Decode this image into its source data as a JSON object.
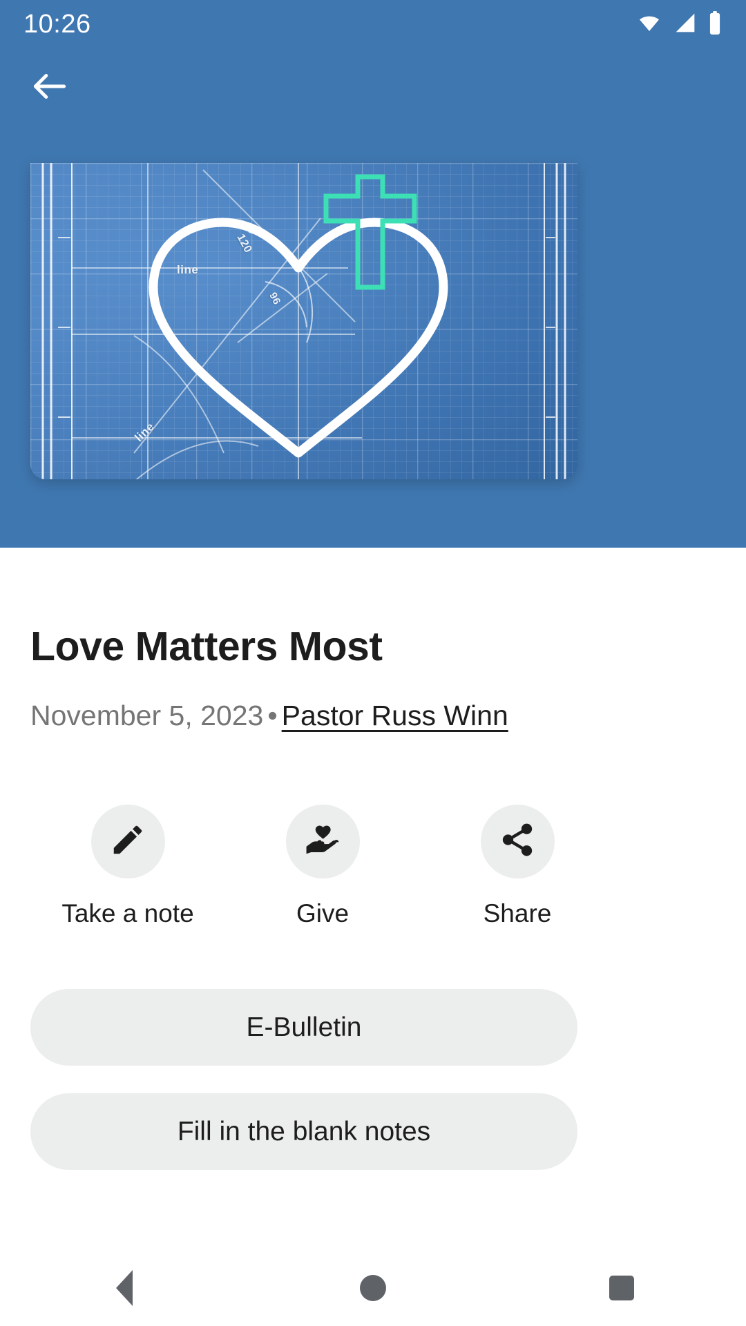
{
  "status_bar": {
    "time": "10:26",
    "icons": [
      "wifi-icon",
      "cell-signal-icon",
      "battery-icon"
    ]
  },
  "header": {
    "back_icon": "arrow-back-icon",
    "background_color": "#3f77b0"
  },
  "hero_image": {
    "alt": "blueprint heart with cross",
    "cross_color": "#3ddfb5",
    "blueprint_color": "#3d78bd",
    "labels": {
      "line_1": "line",
      "line_2": "line",
      "angle_120": "120",
      "angle_96": "96"
    }
  },
  "sermon": {
    "title": "Love Matters Most",
    "date": "November 5, 2023",
    "separator": "•",
    "speaker": "Pastor Russ Winn"
  },
  "actions": [
    {
      "label": "Take a note",
      "icon": "pencil-icon"
    },
    {
      "label": "Give",
      "icon": "hand-holding-heart-icon"
    },
    {
      "label": "Share",
      "icon": "share-nodes-icon"
    }
  ],
  "resources": [
    {
      "label": "E-Bulletin"
    },
    {
      "label": "Fill in the blank notes"
    }
  ],
  "nav_bar": {
    "back": "back-triangle-icon",
    "home": "home-circle-icon",
    "recents": "recents-square-icon"
  }
}
